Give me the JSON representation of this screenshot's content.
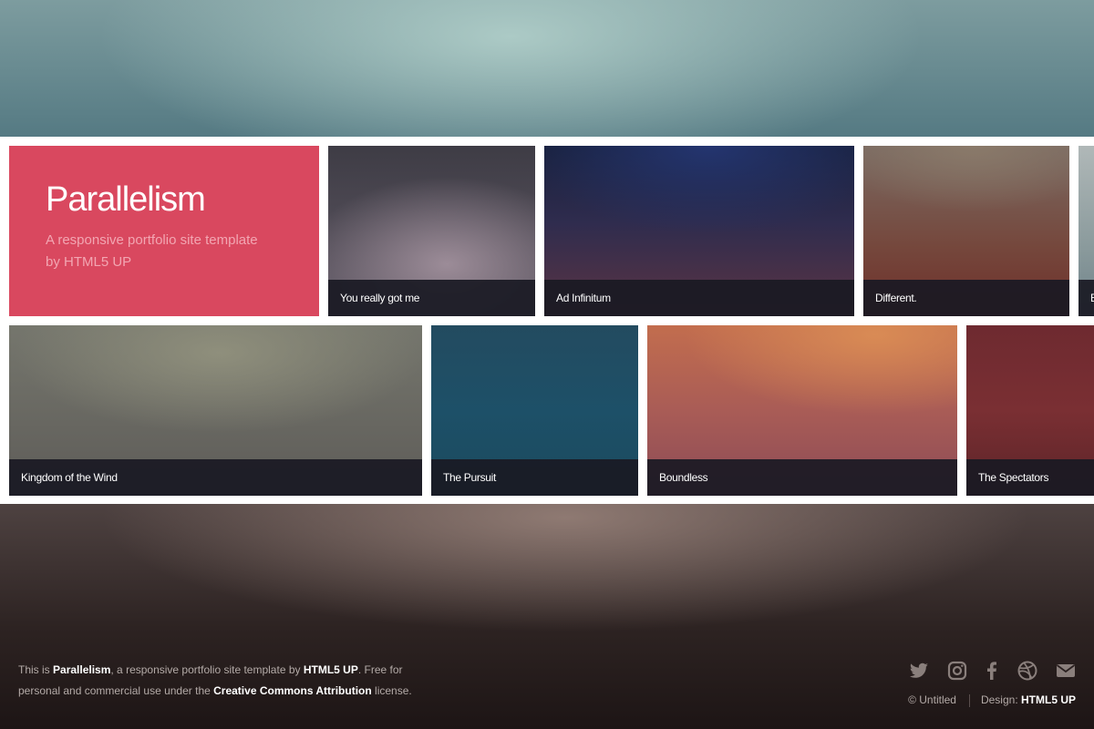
{
  "site": {
    "title": "Parallelism",
    "tagline": "A responsive portfolio site template by HTML5 UP",
    "accent_color": "#d9485f"
  },
  "gallery": {
    "row1": [
      {
        "label": "You really got me"
      },
      {
        "label": "Ad Infinitum"
      },
      {
        "label": "Different."
      },
      {
        "label": "E"
      }
    ],
    "row2": [
      {
        "label": "Kingdom of the Wind"
      },
      {
        "label": "The Pursuit"
      },
      {
        "label": "Boundless"
      },
      {
        "label": "The Spectators"
      }
    ]
  },
  "footer": {
    "text_prefix": "This is ",
    "site_name": "Parallelism",
    "text_middle": ", a responsive portfolio site template by ",
    "author": "HTML5 UP",
    "text_free": ". Free for personal and commercial use under the ",
    "license": "Creative Commons Attribution",
    "text_suffix": " license.",
    "copyright": "© Untitled",
    "design_label": "Design: ",
    "design_credit": "HTML5 UP",
    "social_icons": [
      "twitter-icon",
      "instagram-icon",
      "facebook-icon",
      "dribbble-icon",
      "envelope-icon"
    ]
  }
}
